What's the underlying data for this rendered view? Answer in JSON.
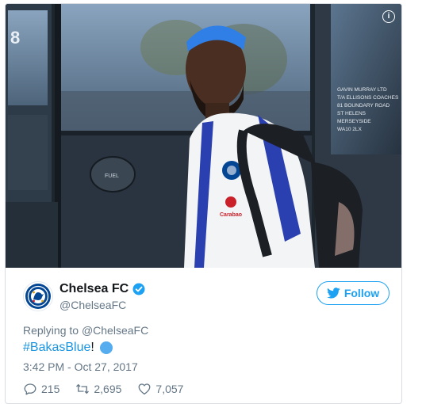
{
  "tweet": {
    "display_name": "Chelsea FC",
    "handle": "@ChelseaFC",
    "follow_label": "Follow",
    "reply_prefix": "Replying to",
    "reply_to": "@ChelseaFC",
    "hashtag": "#BakasBlue",
    "text_suffix": "!",
    "timestamp": "3:42 PM - Oct 27, 2017",
    "replies": "215",
    "retweets": "2,695",
    "likes": "7,057"
  },
  "photo": {
    "bus_text": [
      "GAVIN MURRAY LTD",
      "T/A ELLISONS COACHES",
      "81 BOUNDARY ROAD",
      "ST HELENS",
      "MERSEYSIDE",
      "WA10 2LX"
    ],
    "fuel_label": "FUEL",
    "sponsor": "Carabao",
    "window_number": "8"
  },
  "colors": {
    "accent": "#1da1f2",
    "hashtag": "#1b95e0",
    "chelsea_blue": "#034694"
  }
}
